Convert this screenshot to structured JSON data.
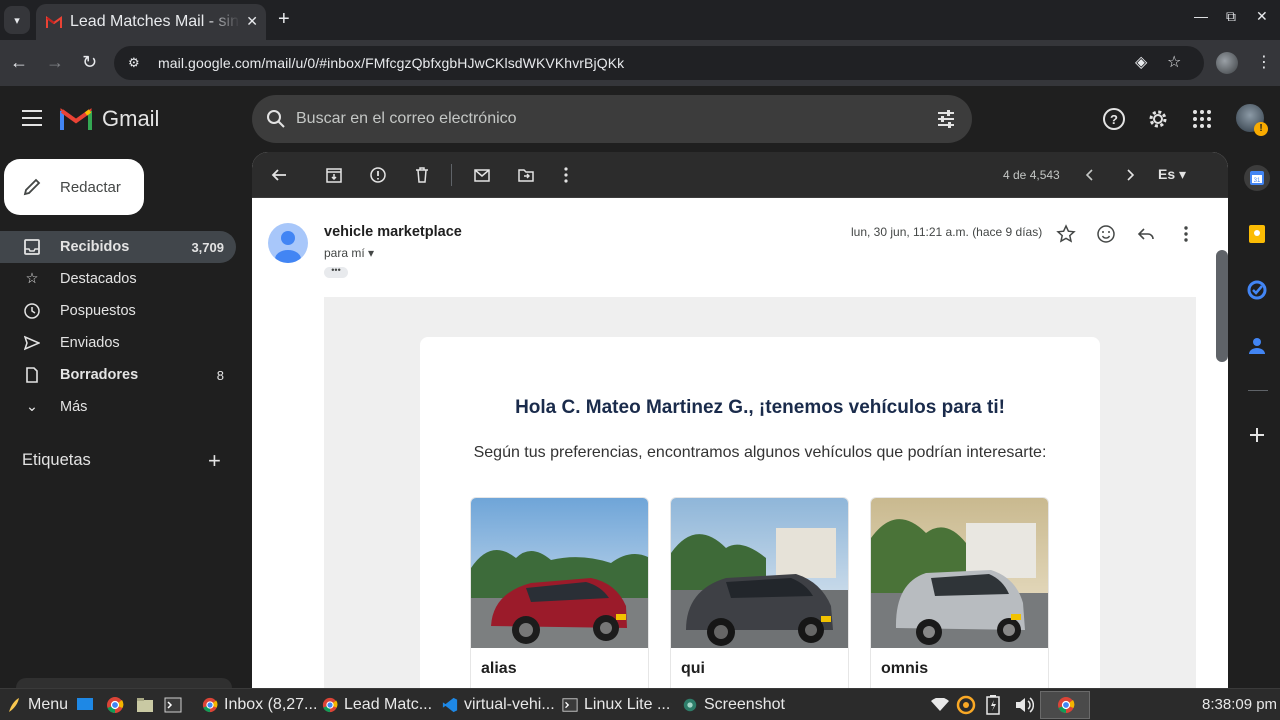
{
  "browser": {
    "tab_title": "Lead Matches Mail - sin",
    "url": "mail.google.com/mail/u/0/#inbox/FMfcgzQbfxgbHJwCKlsdWKVKhvrBjQKk"
  },
  "gmail": {
    "brand": "Gmail",
    "search_placeholder": "Buscar en el correo electrónico",
    "compose_label": "Redactar",
    "nav": [
      {
        "label": "Recibidos",
        "count": "3,709",
        "icon": "inbox-icon"
      },
      {
        "label": "Destacados",
        "count": "",
        "icon": "star-icon"
      },
      {
        "label": "Pospuestos",
        "count": "",
        "icon": "clock-icon"
      },
      {
        "label": "Enviados",
        "count": "",
        "icon": "send-icon"
      },
      {
        "label": "Borradores",
        "count": "8",
        "icon": "draft-icon"
      },
      {
        "label": "Más",
        "count": "",
        "icon": "chevron-down-icon"
      }
    ],
    "labels_heading": "Etiquetas",
    "pager": "4 de 4,543",
    "lang_label": "Es"
  },
  "email": {
    "sender": "vehicle marketplace",
    "to": "para mí",
    "date": "lun, 30 jun, 11:21 a.m. (hace 9 días)",
    "greeting": "Hola C. Mateo Martinez G., ¡tenemos vehículos para ti!",
    "intro": "Según tus preferencias, encontramos algunos vehículos que podrían interesarte:",
    "vehicles": [
      {
        "name": "alias",
        "color": "#9b1b2a"
      },
      {
        "name": "qui",
        "color": "#3e4045"
      },
      {
        "name": "omnis",
        "color": "#b8bcc0"
      }
    ]
  },
  "taskbar": {
    "menu": "Menu",
    "items": [
      "Inbox (8,27...",
      "Lead Matc...",
      "virtual-vehi...",
      "Linux Lite ...",
      "Screenshot"
    ],
    "clock": "8:38:09 pm"
  },
  "colors": {
    "accent_blue": "#a8c7fa",
    "gmail_red": "#ea4335"
  }
}
